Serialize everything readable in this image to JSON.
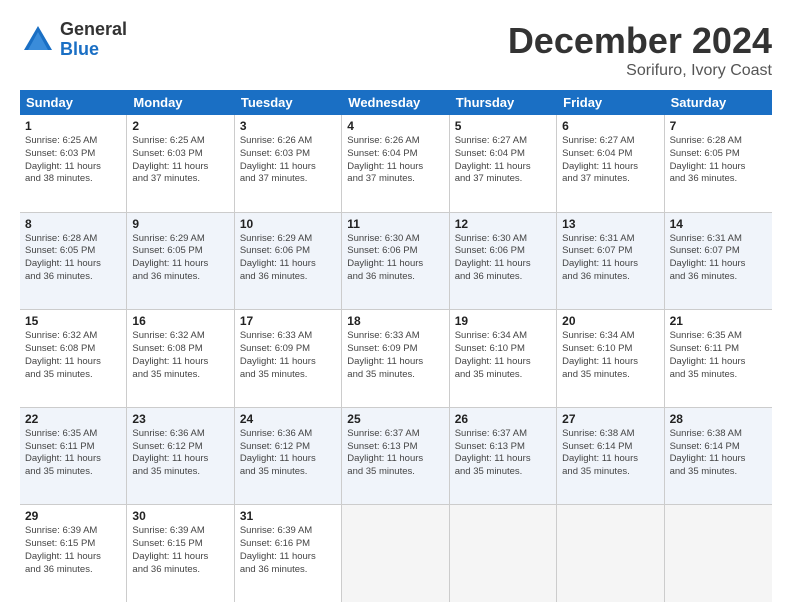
{
  "logo": {
    "general": "General",
    "blue": "Blue"
  },
  "title": "December 2024",
  "location": "Sorifuro, Ivory Coast",
  "weekdays": [
    "Sunday",
    "Monday",
    "Tuesday",
    "Wednesday",
    "Thursday",
    "Friday",
    "Saturday"
  ],
  "weeks": [
    [
      {
        "day": "1",
        "info": "Sunrise: 6:25 AM\nSunset: 6:03 PM\nDaylight: 11 hours\nand 38 minutes."
      },
      {
        "day": "2",
        "info": "Sunrise: 6:25 AM\nSunset: 6:03 PM\nDaylight: 11 hours\nand 37 minutes."
      },
      {
        "day": "3",
        "info": "Sunrise: 6:26 AM\nSunset: 6:03 PM\nDaylight: 11 hours\nand 37 minutes."
      },
      {
        "day": "4",
        "info": "Sunrise: 6:26 AM\nSunset: 6:04 PM\nDaylight: 11 hours\nand 37 minutes."
      },
      {
        "day": "5",
        "info": "Sunrise: 6:27 AM\nSunset: 6:04 PM\nDaylight: 11 hours\nand 37 minutes."
      },
      {
        "day": "6",
        "info": "Sunrise: 6:27 AM\nSunset: 6:04 PM\nDaylight: 11 hours\nand 37 minutes."
      },
      {
        "day": "7",
        "info": "Sunrise: 6:28 AM\nSunset: 6:05 PM\nDaylight: 11 hours\nand 36 minutes."
      }
    ],
    [
      {
        "day": "8",
        "info": "Sunrise: 6:28 AM\nSunset: 6:05 PM\nDaylight: 11 hours\nand 36 minutes."
      },
      {
        "day": "9",
        "info": "Sunrise: 6:29 AM\nSunset: 6:05 PM\nDaylight: 11 hours\nand 36 minutes."
      },
      {
        "day": "10",
        "info": "Sunrise: 6:29 AM\nSunset: 6:06 PM\nDaylight: 11 hours\nand 36 minutes."
      },
      {
        "day": "11",
        "info": "Sunrise: 6:30 AM\nSunset: 6:06 PM\nDaylight: 11 hours\nand 36 minutes."
      },
      {
        "day": "12",
        "info": "Sunrise: 6:30 AM\nSunset: 6:06 PM\nDaylight: 11 hours\nand 36 minutes."
      },
      {
        "day": "13",
        "info": "Sunrise: 6:31 AM\nSunset: 6:07 PM\nDaylight: 11 hours\nand 36 minutes."
      },
      {
        "day": "14",
        "info": "Sunrise: 6:31 AM\nSunset: 6:07 PM\nDaylight: 11 hours\nand 36 minutes."
      }
    ],
    [
      {
        "day": "15",
        "info": "Sunrise: 6:32 AM\nSunset: 6:08 PM\nDaylight: 11 hours\nand 35 minutes."
      },
      {
        "day": "16",
        "info": "Sunrise: 6:32 AM\nSunset: 6:08 PM\nDaylight: 11 hours\nand 35 minutes."
      },
      {
        "day": "17",
        "info": "Sunrise: 6:33 AM\nSunset: 6:09 PM\nDaylight: 11 hours\nand 35 minutes."
      },
      {
        "day": "18",
        "info": "Sunrise: 6:33 AM\nSunset: 6:09 PM\nDaylight: 11 hours\nand 35 minutes."
      },
      {
        "day": "19",
        "info": "Sunrise: 6:34 AM\nSunset: 6:10 PM\nDaylight: 11 hours\nand 35 minutes."
      },
      {
        "day": "20",
        "info": "Sunrise: 6:34 AM\nSunset: 6:10 PM\nDaylight: 11 hours\nand 35 minutes."
      },
      {
        "day": "21",
        "info": "Sunrise: 6:35 AM\nSunset: 6:11 PM\nDaylight: 11 hours\nand 35 minutes."
      }
    ],
    [
      {
        "day": "22",
        "info": "Sunrise: 6:35 AM\nSunset: 6:11 PM\nDaylight: 11 hours\nand 35 minutes."
      },
      {
        "day": "23",
        "info": "Sunrise: 6:36 AM\nSunset: 6:12 PM\nDaylight: 11 hours\nand 35 minutes."
      },
      {
        "day": "24",
        "info": "Sunrise: 6:36 AM\nSunset: 6:12 PM\nDaylight: 11 hours\nand 35 minutes."
      },
      {
        "day": "25",
        "info": "Sunrise: 6:37 AM\nSunset: 6:13 PM\nDaylight: 11 hours\nand 35 minutes."
      },
      {
        "day": "26",
        "info": "Sunrise: 6:37 AM\nSunset: 6:13 PM\nDaylight: 11 hours\nand 35 minutes."
      },
      {
        "day": "27",
        "info": "Sunrise: 6:38 AM\nSunset: 6:14 PM\nDaylight: 11 hours\nand 35 minutes."
      },
      {
        "day": "28",
        "info": "Sunrise: 6:38 AM\nSunset: 6:14 PM\nDaylight: 11 hours\nand 35 minutes."
      }
    ],
    [
      {
        "day": "29",
        "info": "Sunrise: 6:39 AM\nSunset: 6:15 PM\nDaylight: 11 hours\nand 36 minutes."
      },
      {
        "day": "30",
        "info": "Sunrise: 6:39 AM\nSunset: 6:15 PM\nDaylight: 11 hours\nand 36 minutes."
      },
      {
        "day": "31",
        "info": "Sunrise: 6:39 AM\nSunset: 6:16 PM\nDaylight: 11 hours\nand 36 minutes."
      },
      {
        "day": "",
        "info": ""
      },
      {
        "day": "",
        "info": ""
      },
      {
        "day": "",
        "info": ""
      },
      {
        "day": "",
        "info": ""
      }
    ]
  ]
}
